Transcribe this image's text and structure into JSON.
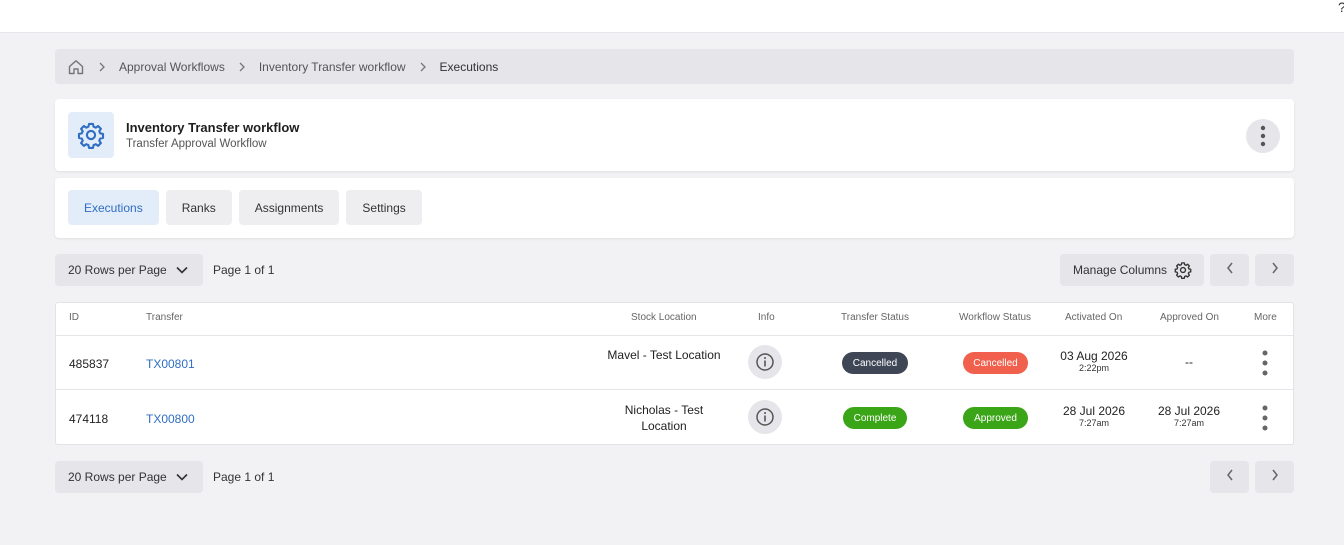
{
  "breadcrumb": {
    "items": [
      "Approval Workflows",
      "Inventory Transfer workflow"
    ],
    "current": "Executions"
  },
  "header": {
    "title": "Inventory Transfer workflow",
    "subtitle": "Transfer Approval Workflow"
  },
  "tabs": [
    {
      "label": "Executions",
      "active": true
    },
    {
      "label": "Ranks",
      "active": false
    },
    {
      "label": "Assignments",
      "active": false
    },
    {
      "label": "Settings",
      "active": false
    }
  ],
  "pager": {
    "rows_per_page": "20 Rows per Page",
    "page_text": "Page 1 of 1"
  },
  "toolbar": {
    "manage_columns": "Manage Columns"
  },
  "table": {
    "columns": [
      "ID",
      "Transfer",
      "Stock Location",
      "Info",
      "Transfer Status",
      "Workflow Status",
      "Activated On",
      "Approved On",
      "More"
    ],
    "rows": [
      {
        "id": "485837",
        "transfer": "TX00801",
        "stock_location": "Mavel - Test Location",
        "transfer_status": "Cancelled",
        "workflow_status": "Cancelled",
        "activated_date": "03 Aug 2026",
        "activated_time": "2:22pm",
        "approved_date": "--",
        "approved_time": ""
      },
      {
        "id": "474118",
        "transfer": "TX00800",
        "stock_location": "Nicholas - Test Location",
        "transfer_status": "Complete",
        "workflow_status": "Approved",
        "activated_date": "28 Jul 2026",
        "activated_time": "7:27am",
        "approved_date": "28 Jul 2026",
        "approved_time": "7:27am"
      }
    ]
  },
  "colors": {
    "accent": "#2f6ec2",
    "badge_dark": "#3f4656",
    "badge_red": "#f0604d",
    "badge_green": "#3aa517"
  },
  "icons": [
    "home-icon",
    "chevron-right-icon",
    "gear-icon",
    "more-vertical-icon",
    "chevron-down-icon",
    "chevron-left-icon",
    "info-icon"
  ]
}
